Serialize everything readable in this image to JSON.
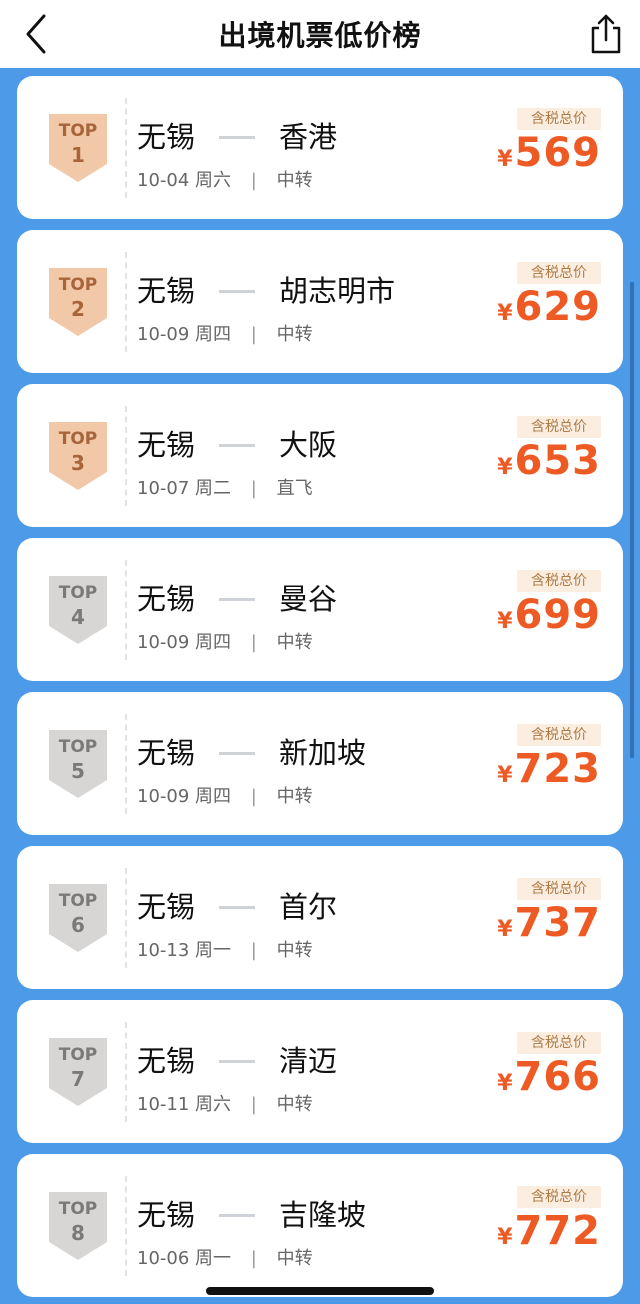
{
  "header": {
    "title": "出境机票低价榜"
  },
  "icons": {
    "back": "back-chevron-icon",
    "share": "share-icon"
  },
  "colors": {
    "background": "#4d9be8",
    "price": "#ee5a24",
    "badge_bronze": "#f1c9a8",
    "badge_silver": "#d8d6d4"
  },
  "tax_label": "含税总价",
  "currency": "¥",
  "rank_prefix": "TOP",
  "items": [
    {
      "rank": "1",
      "from": "无锡",
      "to": "香港",
      "date": "10-04",
      "weekday": "周六",
      "type": "中转",
      "price": "569",
      "tier": "bronze"
    },
    {
      "rank": "2",
      "from": "无锡",
      "to": "胡志明市",
      "date": "10-09",
      "weekday": "周四",
      "type": "中转",
      "price": "629",
      "tier": "bronze"
    },
    {
      "rank": "3",
      "from": "无锡",
      "to": "大阪",
      "date": "10-07",
      "weekday": "周二",
      "type": "直飞",
      "price": "653",
      "tier": "bronze"
    },
    {
      "rank": "4",
      "from": "无锡",
      "to": "曼谷",
      "date": "10-09",
      "weekday": "周四",
      "type": "中转",
      "price": "699",
      "tier": "silver"
    },
    {
      "rank": "5",
      "from": "无锡",
      "to": "新加坡",
      "date": "10-09",
      "weekday": "周四",
      "type": "中转",
      "price": "723",
      "tier": "silver"
    },
    {
      "rank": "6",
      "from": "无锡",
      "to": "首尔",
      "date": "10-13",
      "weekday": "周一",
      "type": "中转",
      "price": "737",
      "tier": "silver"
    },
    {
      "rank": "7",
      "from": "无锡",
      "to": "清迈",
      "date": "10-11",
      "weekday": "周六",
      "type": "中转",
      "price": "766",
      "tier": "silver"
    },
    {
      "rank": "8",
      "from": "无锡",
      "to": "吉隆坡",
      "date": "10-06",
      "weekday": "周一",
      "type": "中转",
      "price": "772",
      "tier": "silver"
    }
  ]
}
